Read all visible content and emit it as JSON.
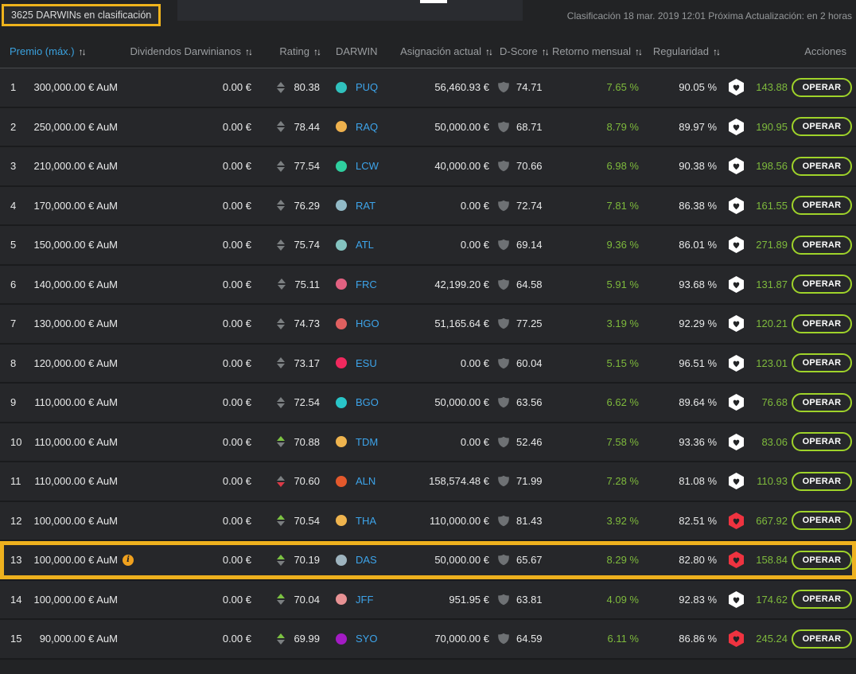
{
  "toolbar": {
    "count_label": "3625 DARWINs en clasificación",
    "update_label": "Clasificación 18 mar. 2019 12:01 Próxima Actualización: en 2 horas"
  },
  "icons": {
    "sort": "↑↓",
    "info": "i"
  },
  "colors": {
    "highlight": "#eeb11e",
    "badge_white": "#ffffff",
    "badge_red": "#ef3340",
    "positive_green": "#7eba3c",
    "operar_border": "#9fd32a",
    "darwin_link": "#3da4ea"
  },
  "table": {
    "headers": {
      "prize": "Premio (máx.)",
      "dividends": "Dividendos Darwinianos",
      "rating": "Rating",
      "darwin": "DARWIN",
      "allocation": "Asignación actual",
      "dscore": "D-Score",
      "monthly_return": "Retorno mensual",
      "regularity": "Regularidad",
      "actions": "Acciones"
    },
    "action_label": "OPERAR",
    "rows": [
      {
        "rank": "1",
        "prize": "300,000.00 € AuM",
        "info": false,
        "dividends": "0.00 €",
        "trend": "flat",
        "rating": "80.38",
        "name": "PUQ",
        "dot_color": "#30c1bd",
        "allocation": "56,460.93 €",
        "dscore": "74.71",
        "monthly_return": "7.65 %",
        "regularity": "90.05 %",
        "badge": "white",
        "score": "143.88",
        "highlighted": false
      },
      {
        "rank": "2",
        "prize": "250,000.00 € AuM",
        "info": false,
        "dividends": "0.00 €",
        "trend": "flat",
        "rating": "78.44",
        "name": "RAQ",
        "dot_color": "#eeb14d",
        "allocation": "50,000.00 €",
        "dscore": "68.71",
        "monthly_return": "8.79 %",
        "regularity": "89.97 %",
        "badge": "white",
        "score": "190.95",
        "highlighted": false
      },
      {
        "rank": "3",
        "prize": "210,000.00 € AuM",
        "info": false,
        "dividends": "0.00 €",
        "trend": "flat",
        "rating": "77.54",
        "name": "LCW",
        "dot_color": "#2fcf9f",
        "allocation": "40,000.00 €",
        "dscore": "70.66",
        "monthly_return": "6.98 %",
        "regularity": "90.38 %",
        "badge": "white",
        "score": "198.56",
        "highlighted": false
      },
      {
        "rank": "4",
        "prize": "170,000.00 € AuM",
        "info": false,
        "dividends": "0.00 €",
        "trend": "flat",
        "rating": "76.29",
        "name": "RAT",
        "dot_color": "#92bac7",
        "allocation": "0.00 €",
        "dscore": "72.74",
        "monthly_return": "7.81 %",
        "regularity": "86.38 %",
        "badge": "white",
        "score": "161.55",
        "highlighted": false
      },
      {
        "rank": "5",
        "prize": "150,000.00 € AuM",
        "info": false,
        "dividends": "0.00 €",
        "trend": "flat",
        "rating": "75.74",
        "name": "ATL",
        "dot_color": "#84c3c0",
        "allocation": "0.00 €",
        "dscore": "69.14",
        "monthly_return": "9.36 %",
        "regularity": "86.01 %",
        "badge": "white",
        "score": "271.89",
        "highlighted": false
      },
      {
        "rank": "6",
        "prize": "140,000.00 € AuM",
        "info": false,
        "dividends": "0.00 €",
        "trend": "flat",
        "rating": "75.11",
        "name": "FRC",
        "dot_color": "#e26181",
        "allocation": "42,199.20 €",
        "dscore": "64.58",
        "monthly_return": "5.91 %",
        "regularity": "93.68 %",
        "badge": "white",
        "score": "131.87",
        "highlighted": false
      },
      {
        "rank": "7",
        "prize": "130,000.00 € AuM",
        "info": false,
        "dividends": "0.00 €",
        "trend": "flat",
        "rating": "74.73",
        "name": "HGO",
        "dot_color": "#e06060",
        "allocation": "51,165.64 €",
        "dscore": "77.25",
        "monthly_return": "3.19 %",
        "regularity": "92.29 %",
        "badge": "white",
        "score": "120.21",
        "highlighted": false
      },
      {
        "rank": "8",
        "prize": "120,000.00 € AuM",
        "info": false,
        "dividends": "0.00 €",
        "trend": "flat",
        "rating": "73.17",
        "name": "ESU",
        "dot_color": "#f0295e",
        "allocation": "0.00 €",
        "dscore": "60.04",
        "monthly_return": "5.15 %",
        "regularity": "96.51 %",
        "badge": "white",
        "score": "123.01",
        "highlighted": false
      },
      {
        "rank": "9",
        "prize": "110,000.00 € AuM",
        "info": false,
        "dividends": "0.00 €",
        "trend": "flat",
        "rating": "72.54",
        "name": "BGO",
        "dot_color": "#29c5c8",
        "allocation": "50,000.00 €",
        "dscore": "63.56",
        "monthly_return": "6.62 %",
        "regularity": "89.64 %",
        "badge": "white",
        "score": "76.68",
        "highlighted": false
      },
      {
        "rank": "10",
        "prize": "110,000.00 € AuM",
        "info": false,
        "dividends": "0.00 €",
        "trend": "up",
        "rating": "70.88",
        "name": "TDM",
        "dot_color": "#efb44e",
        "allocation": "0.00 €",
        "dscore": "52.46",
        "monthly_return": "7.58 %",
        "regularity": "93.36 %",
        "badge": "white",
        "score": "83.06",
        "highlighted": false
      },
      {
        "rank": "11",
        "prize": "110,000.00 € AuM",
        "info": false,
        "dividends": "0.00 €",
        "trend": "down",
        "rating": "70.60",
        "name": "ALN",
        "dot_color": "#e4592c",
        "allocation": "158,574.48 €",
        "dscore": "71.99",
        "monthly_return": "7.28 %",
        "regularity": "81.08 %",
        "badge": "white",
        "score": "110.93",
        "highlighted": false
      },
      {
        "rank": "12",
        "prize": "100,000.00 € AuM",
        "info": false,
        "dividends": "0.00 €",
        "trend": "up",
        "rating": "70.54",
        "name": "THA",
        "dot_color": "#efb44e",
        "allocation": "110,000.00 €",
        "dscore": "81.43",
        "monthly_return": "3.92 %",
        "regularity": "82.51 %",
        "badge": "red",
        "score": "667.92",
        "highlighted": false
      },
      {
        "rank": "13",
        "prize": "100,000.00 € AuM",
        "info": true,
        "dividends": "0.00 €",
        "trend": "up",
        "rating": "70.19",
        "name": "DAS",
        "dot_color": "#9eb4bf",
        "allocation": "50,000.00 €",
        "dscore": "65.67",
        "monthly_return": "8.29 %",
        "regularity": "82.80 %",
        "badge": "red",
        "score": "158.84",
        "highlighted": true
      },
      {
        "rank": "14",
        "prize": "100,000.00 € AuM",
        "info": false,
        "dividends": "0.00 €",
        "trend": "up",
        "rating": "70.04",
        "name": "JFF",
        "dot_color": "#e89294",
        "allocation": "951.95 €",
        "dscore": "63.81",
        "monthly_return": "4.09 %",
        "regularity": "92.83 %",
        "badge": "white",
        "score": "174.62",
        "highlighted": false
      },
      {
        "rank": "15",
        "prize": "90,000.00 € AuM",
        "info": false,
        "dividends": "0.00 €",
        "trend": "up",
        "rating": "69.99",
        "name": "SYO",
        "dot_color": "#a31bc4",
        "allocation": "70,000.00 €",
        "dscore": "64.59",
        "monthly_return": "6.11 %",
        "regularity": "86.86 %",
        "badge": "red",
        "score": "245.24",
        "highlighted": false
      }
    ]
  }
}
